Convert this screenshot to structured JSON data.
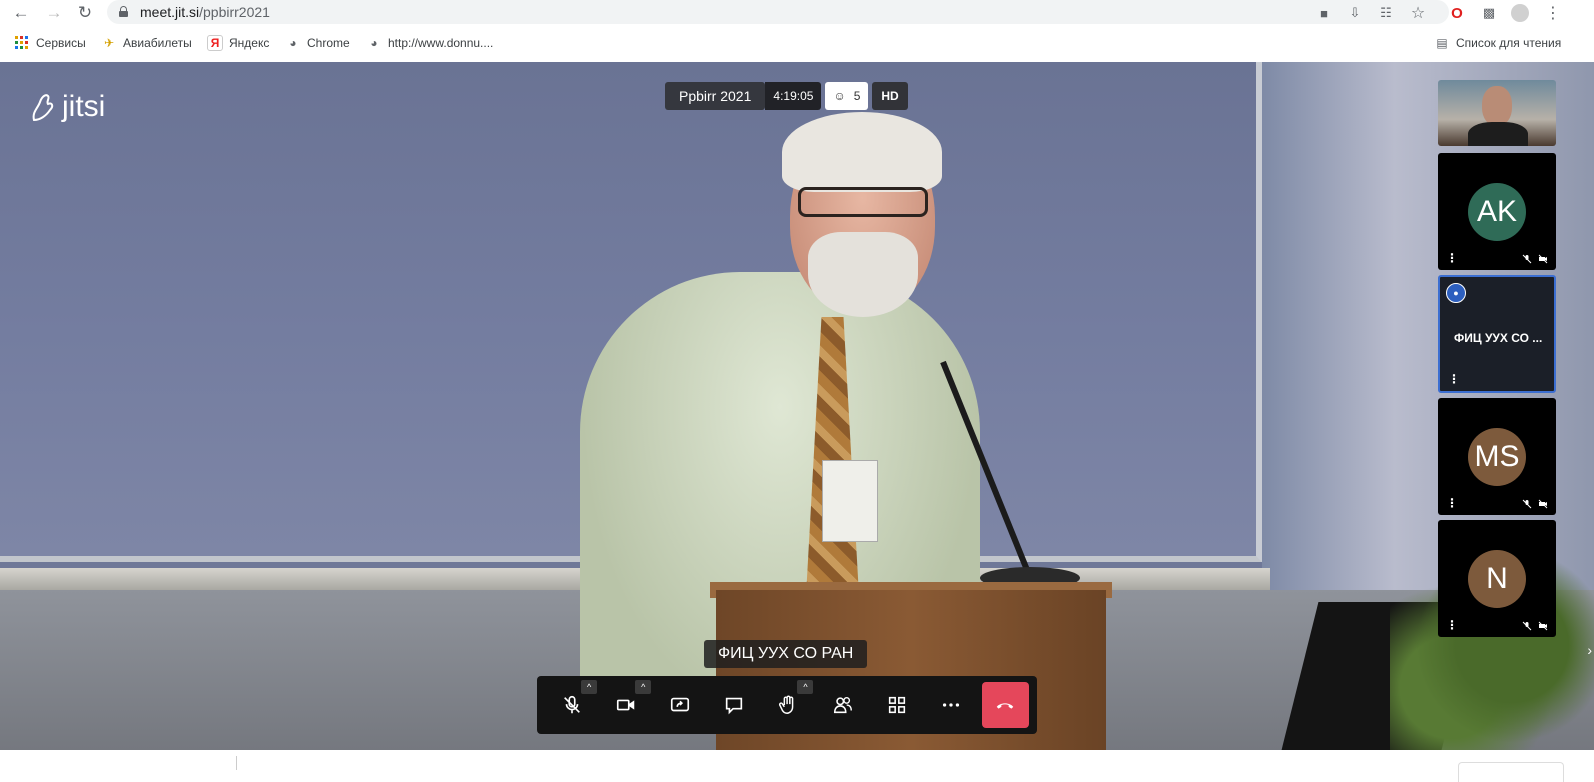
{
  "browser": {
    "url_host": "meet.jit.si",
    "url_path": "/ppbirr2021",
    "bookmarks": [
      {
        "label": "Сервисы",
        "icon": "apps-grid-icon"
      },
      {
        "label": "Авиабилеты",
        "icon": "plane-icon"
      },
      {
        "label": "Яндекс",
        "icon": "yandex-icon"
      },
      {
        "label": "Chrome",
        "icon": "globe-icon"
      },
      {
        "label": "http://www.donnu....",
        "icon": "globe-icon"
      }
    ],
    "reading_list": "Список для чтения"
  },
  "meeting": {
    "logo_text": "jitsi",
    "subject": "Ppbirr 2021",
    "timer": "4:19:05",
    "participant_count": "5",
    "quality": "HD",
    "speaker_name": "ФИЦ УУХ СО РАН"
  },
  "filmstrip": [
    {
      "type": "camera"
    },
    {
      "type": "avatar",
      "initials": "AK",
      "color": "#2f6b57"
    },
    {
      "type": "dominant",
      "name": "ФИЦ УУХ СО ..."
    },
    {
      "type": "avatar",
      "initials": "MS",
      "color": "#7d5a3c"
    },
    {
      "type": "avatar",
      "initials": "N",
      "color": "#7d5a3c"
    }
  ],
  "colors": {
    "hangup": "#e5475b",
    "active_border": "#3b6ed1"
  }
}
